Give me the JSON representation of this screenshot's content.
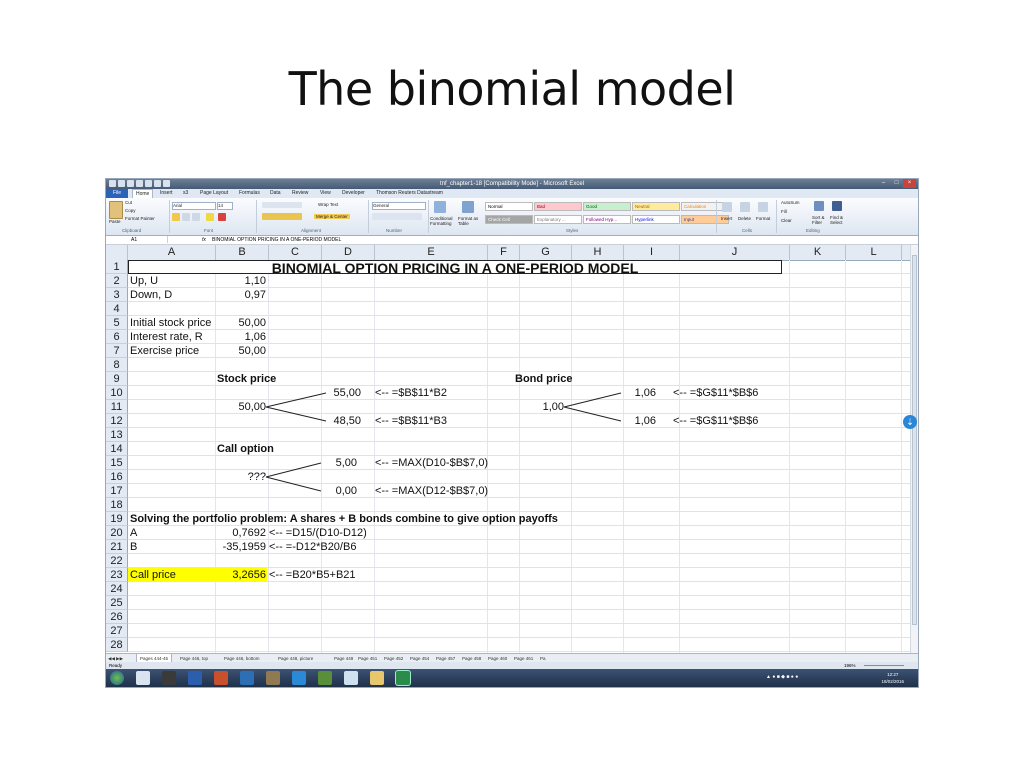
{
  "slide": {
    "title": "The binomial model"
  },
  "window": {
    "title": "tnf_chapter1-18 [Compatibility Mode] - Microsoft Excel"
  },
  "ribbon_tabs": [
    "File",
    "Home",
    "Insert",
    "s3",
    "Page Layout",
    "Formulas",
    "Data",
    "Review",
    "View",
    "Developer",
    "Thomson Reuters Datastream"
  ],
  "ribbon": {
    "clipboard": {
      "paste": "Paste",
      "cut": "Cut",
      "copy": "Copy",
      "format_painter": "Format Painter",
      "group": "Clipboard"
    },
    "font": {
      "name": "Arial",
      "size": "14",
      "group": "Font"
    },
    "alignment": {
      "wrap": "Wrap Text",
      "merge": "Merge & Center",
      "group": "Alignment"
    },
    "number": {
      "format": "General",
      "group": "Number"
    },
    "styles": {
      "cond": "Conditional Formatting",
      "table": "Format as Table",
      "group": "Styles",
      "cells": [
        {
          "label": "Normal",
          "bg": "#ffffff",
          "fg": "#000000"
        },
        {
          "label": "Bad",
          "bg": "#ffc7ce",
          "fg": "#9c0006"
        },
        {
          "label": "Good",
          "bg": "#c6efce",
          "fg": "#006100"
        },
        {
          "label": "Neutral",
          "bg": "#ffeb9c",
          "fg": "#9c6500"
        },
        {
          "label": "Calculation",
          "bg": "#f2f2f2",
          "fg": "#fa7d00"
        },
        {
          "label": "Check Cell",
          "bg": "#a5a5a5",
          "fg": "#ffffff"
        },
        {
          "label": "Explanatory ...",
          "bg": "#ffffff",
          "fg": "#7f7f7f"
        },
        {
          "label": "Followed Hyp...",
          "bg": "#ffffff",
          "fg": "#800080"
        },
        {
          "label": "Hyperlink",
          "bg": "#ffffff",
          "fg": "#0000ff"
        },
        {
          "label": "Input",
          "bg": "#ffcc99",
          "fg": "#3f3f76"
        }
      ]
    },
    "cells_group": {
      "insert": "Insert",
      "delete": "Delete",
      "format": "Format",
      "group": "Cells"
    },
    "editing": {
      "autosum": "AutoSum",
      "fill": "Fill",
      "clear": "Clear",
      "sort": "Sort & Filter",
      "find": "Find & Select",
      "group": "Editing"
    }
  },
  "formula_bar": {
    "name_box": "A1",
    "fx": "fx",
    "formula": "BINOMIAL OPTION PRICING IN A ONE-PERIOD MODEL"
  },
  "columns": [
    "A",
    "B",
    "C",
    "D",
    "E",
    "F",
    "G",
    "H",
    "I",
    "J",
    "K",
    "L"
  ],
  "rows": [
    "1",
    "2",
    "3",
    "4",
    "5",
    "6",
    "7",
    "8",
    "9",
    "10",
    "11",
    "12",
    "13",
    "14",
    "15",
    "16",
    "17",
    "18",
    "19",
    "20",
    "21",
    "22",
    "23",
    "24",
    "25",
    "26",
    "27",
    "28"
  ],
  "sheet": {
    "title": "BINOMIAL OPTION PRICING IN A ONE-PERIOD MODEL",
    "up_label": "Up, U",
    "up_val": "1,10",
    "down_label": "Down, D",
    "down_val": "0,97",
    "s0_label": "Initial stock price",
    "s0_val": "50,00",
    "r_label": "Interest rate, R",
    "r_val": "1,06",
    "x_label": "Exercise price",
    "x_val": "50,00",
    "stock_hdr": "Stock price",
    "bond_hdr": "Bond price",
    "s_up": "55,00",
    "s_up_f": "<--  =$B$11*B2",
    "s_0": "50,00",
    "s_dn": "48,50",
    "s_dn_f": "<--  =$B$11*B3",
    "b_up": "1,06",
    "b_up_f": "<--  =$G$11*$B$6",
    "b_0": "1,00",
    "b_dn": "1,06",
    "b_dn_f": "<--  =$G$11*$B$6",
    "call_hdr": "Call option",
    "c_up": "5,00",
    "c_up_f": "<--  =MAX(D10-$B$7,0)",
    "c_0": "???",
    "c_dn": "0,00",
    "c_dn_f": "<--  =MAX(D12-$B$7,0)",
    "solving": "Solving the portfolio problem:  A shares + B bonds combine to give option payoffs",
    "a_label": "A",
    "a_val": "0,7692",
    "a_f": "<--  =D15/(D10-D12)",
    "b_label": "B",
    "b_val": "-35,1959",
    "b_f": "<--  =-D12*B20/B6",
    "call_label": "Call price",
    "call_val": "3,2656",
    "call_f": "<--  =B20*B5+B21",
    "highlight": "#ffff00"
  },
  "sheet_tabs": [
    "Pages 444-45",
    "Page 446, top",
    "Page 446, bottom",
    "Page 448, picture",
    "Page 449",
    "Page 451",
    "Page 452",
    "Page 454",
    "Page 457",
    "Page 458",
    "Page 460",
    "Page 461",
    "Pa"
  ],
  "status": {
    "ready": "Ready",
    "zoom": "196%"
  },
  "clock": {
    "time": "12:27",
    "date": "18/02/2016"
  }
}
